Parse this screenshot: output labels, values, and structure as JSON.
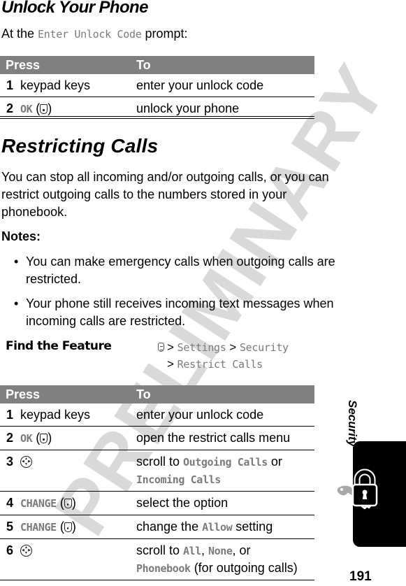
{
  "unlock_section": {
    "heading": "Unlock Your Phone",
    "intro_prefix": "At the ",
    "intro_code": "Enter Unlock Code",
    "intro_suffix": " prompt:",
    "table": {
      "headers": [
        "Press",
        "To"
      ],
      "rows": [
        {
          "num": "1",
          "press": "keypad keys",
          "to": "enter your unlock code"
        },
        {
          "num": "2",
          "press_code": "OK",
          "press_icon": "center-softkey-icon",
          "to": "unlock your phone"
        }
      ]
    }
  },
  "restrict_section": {
    "heading": "Restricting Calls",
    "paragraph": "You can stop all incoming and/or outgoing calls, or you can restrict outgoing calls to the numbers stored in your phonebook.",
    "notes_label": "Notes:",
    "notes": [
      "You can make emergency calls when outgoing calls are restricted.",
      "Your phone still receives incoming text messages when incoming calls are restricted."
    ],
    "bullet": "•",
    "find_feature": {
      "label": "Find the Feature",
      "icon": "menu-key-icon",
      "sep": ">",
      "path": [
        "Settings",
        "Security",
        "Restrict Calls"
      ]
    },
    "table": {
      "headers": [
        "Press",
        "To"
      ],
      "rows": [
        {
          "num": "1",
          "press": "keypad keys",
          "to": "enter your unlock code"
        },
        {
          "num": "2",
          "press_code": "OK",
          "to": "open the restrict calls menu"
        },
        {
          "num": "3",
          "press_icon": "nav-key-icon",
          "to_prefix": "scroll to ",
          "to_code1": "Outgoing Calls",
          "to_mid": " or ",
          "to_code2": "Incoming Calls"
        },
        {
          "num": "4",
          "press_code": "CHANGE",
          "to": "select the option"
        },
        {
          "num": "5",
          "press_code": "CHANGE",
          "to_prefix": "change the ",
          "to_code1": "Allow",
          "to_suffix": " setting"
        },
        {
          "num": "6",
          "press_icon": "nav-key-icon",
          "to_prefix": "scroll to ",
          "to_code1": "All",
          "to_mid": ", ",
          "to_code2": "None",
          "to_mid2": ", or ",
          "to_code3": "Phonebook",
          "to_suffix": " (for outgoing calls)"
        }
      ]
    }
  },
  "sidebar": {
    "section_label": "Security",
    "tab_icon": "lock-and-key-icon"
  },
  "page_number": "191",
  "watermark": "PRELIMINARY",
  "paren_open": "(",
  "paren_close": ")",
  "colors": {
    "header_bg": "#808080",
    "code_text": "#7a7a7a",
    "watermark": "#d9d9d9",
    "tab": "#000000"
  }
}
